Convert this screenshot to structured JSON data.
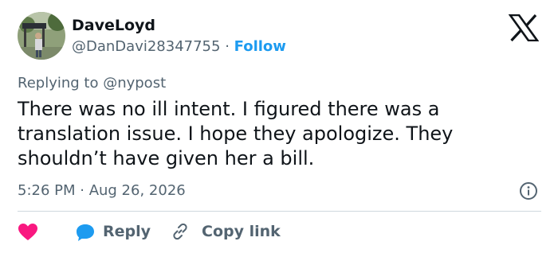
{
  "user": {
    "display_name": "DaveLoyd",
    "handle": "@DanDavi28347755",
    "separator": " · ",
    "follow_label": "Follow"
  },
  "brand": {
    "logo_icon": "x-logo-icon"
  },
  "tweet": {
    "replying_to": "Replying to @nypost",
    "text": "There was no ill intent. I figured there was a translation issue. I hope they apologize. They shouldn’t have given her a bill.",
    "timestamp": "5:26 PM · Aug 26, 2026"
  },
  "actions": {
    "reply_label": "Reply",
    "copy_link_label": "Copy link"
  },
  "colors": {
    "accent": "#1d9bf0",
    "heart": "#f91880",
    "muted_text": "#536471",
    "primary_text": "#0f1419",
    "divider": "#cfd9de"
  }
}
